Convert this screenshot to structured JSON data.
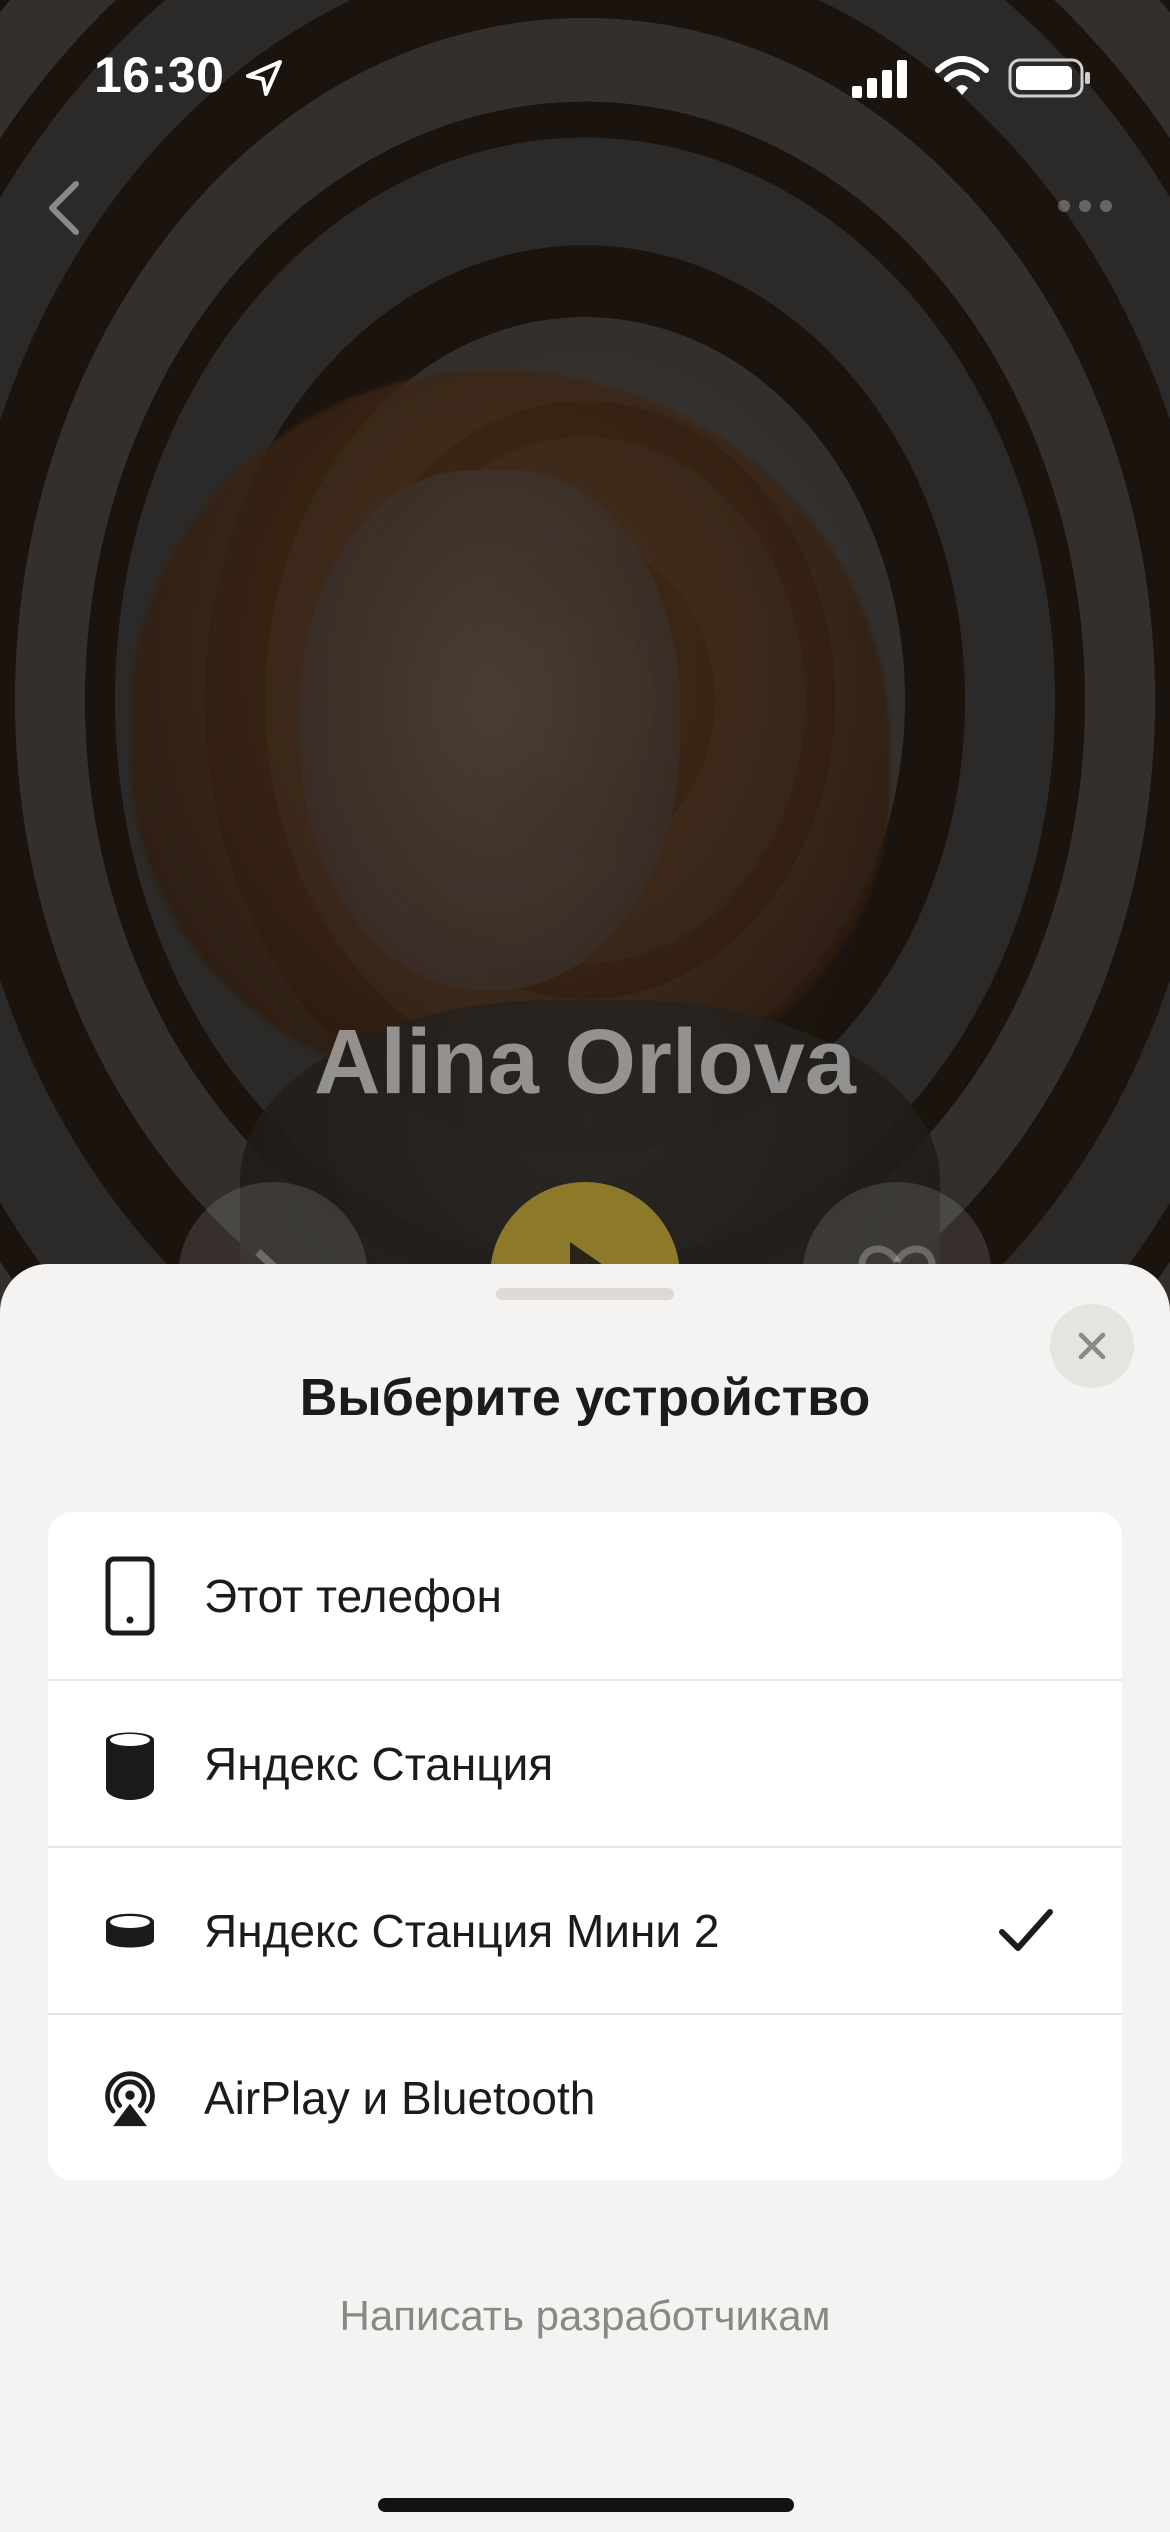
{
  "status_bar": {
    "time": "16:30",
    "location_icon": "location-arrow-icon",
    "signal_icon": "cellular-signal-icon",
    "wifi_icon": "wifi-icon",
    "battery_icon": "battery-icon"
  },
  "player": {
    "artist_name": "Alina Orlova",
    "back_icon": "chevron-left-icon",
    "more_icon": "more-dots-icon",
    "play_icon": "play-icon",
    "share_icon": "share-icon",
    "like_icon": "heart-icon",
    "accent_color": "#8c7a2a"
  },
  "device_sheet": {
    "title": "Выберите устройство",
    "close_icon": "close-icon",
    "devices": [
      {
        "label": "Этот телефон",
        "icon": "phone-icon",
        "selected": false
      },
      {
        "label": "Яндекс Станция",
        "icon": "smart-speaker-icon",
        "selected": false
      },
      {
        "label": "Яндекс Станция Мини 2",
        "icon": "mini-speaker-icon",
        "selected": true
      },
      {
        "label": "AirPlay и Bluetooth",
        "icon": "airplay-icon",
        "selected": false
      }
    ],
    "selected_icon": "checkmark-icon",
    "feedback_link": "Написать разработчикам"
  }
}
